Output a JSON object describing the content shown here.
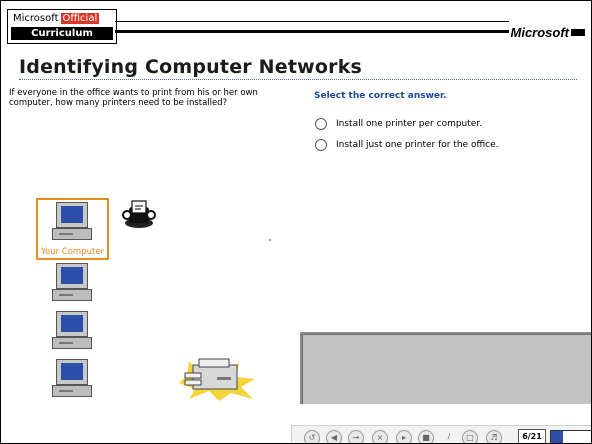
{
  "header": {
    "logo_top": "Microsoft",
    "logo_official": "Official",
    "logo_bottom": "Curriculum",
    "brand": "Microsoft"
  },
  "page": {
    "title": "Identifying Computer Networks",
    "question": "If everyone in the office wants to print from his or her own computer, how many printers need to be installed?",
    "instruction": "Select the correct answer.",
    "options": [
      {
        "label": "Install one printer per computer.",
        "selected": false
      },
      {
        "label": "Install just one printer for the office.",
        "selected": false
      }
    ],
    "your_computer_label": "Your Computer"
  },
  "navbar": {
    "page_counter": "6/21",
    "progress": 0.29,
    "buttons": [
      "back-icon",
      "home-icon",
      "forward-icon",
      "stop-icon",
      "play-icon",
      "pause-icon",
      "pen-icon",
      "caption-icon",
      "audio-icon"
    ]
  },
  "colors": {
    "accent_orange": "#e88b1e",
    "instruction_blue": "#1f4a9a",
    "screen_blue": "#2d4fa8",
    "logo_red": "#d6362b"
  }
}
